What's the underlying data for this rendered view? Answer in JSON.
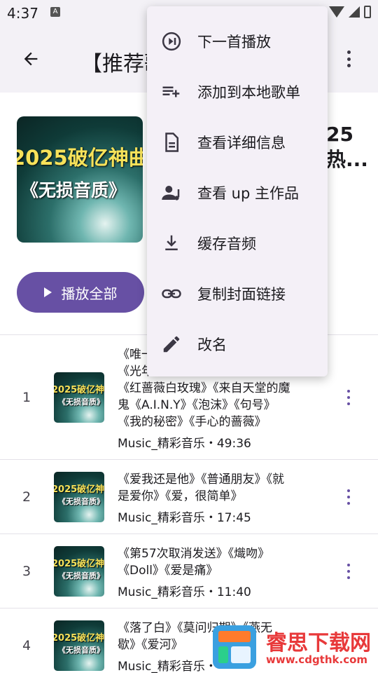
{
  "status": {
    "time": "4:37",
    "app_badge": "A"
  },
  "appbar": {
    "title": "【推荐歌"
  },
  "playlist": {
    "cover_line1": "2025破亿神曲",
    "cover_line2": "《无损音质》",
    "side_title_line1": "25",
    "side_title_line2": "热..."
  },
  "play_all_label": "播放全部",
  "songs": [
    {
      "index": "1",
      "title": "《唯一》《光年之外》《告白气球》《说散就散》《红蔷薇白玫瑰》《来自天堂的魔鬼《A.I.N.Y》《泡沫》《句号》《我的秘密》《手心的蔷薇》",
      "title_lines": [
        "《唯一",
        "《光年之外》《告白气球》《说散就散》",
        "《红蔷薇白玫瑰》《来自天堂的魔",
        "鬼《A.I.N.Y》《泡沫》《句号》",
        "《我的秘密》《手心的蔷薇》"
      ],
      "meta": "Music_精彩音乐・49:36",
      "thumb_line1": "2025破亿神曲",
      "thumb_line2": "《无损音质》"
    },
    {
      "index": "2",
      "title_lines": [
        "《爱我还是他》《普通朋友》《就",
        "是爱你》《爱，很简单》"
      ],
      "meta": "Music_精彩音乐・17:45",
      "thumb_line1": "2025破亿神曲",
      "thumb_line2": "《无损音质》"
    },
    {
      "index": "3",
      "title_lines": [
        "《第57次取消发送》《熾吻》",
        "《Doll》《爱是痛》"
      ],
      "meta": "Music_精彩音乐・11:40",
      "thumb_line1": "2025破亿神曲",
      "thumb_line2": "《无损音质》"
    },
    {
      "index": "4",
      "title_lines": [
        "《落了白》《莫问归期》《燕无",
        "歇》《爱河》"
      ],
      "meta": "Music_精彩音乐・",
      "thumb_line1": "2025破亿神曲",
      "thumb_line2": "《无损音质》"
    }
  ],
  "menu": {
    "items": [
      {
        "label": "下一首播放",
        "icon": "play-next-icon"
      },
      {
        "label": "添加到本地歌单",
        "icon": "playlist-add-icon"
      },
      {
        "label": "查看详细信息",
        "icon": "document-icon"
      },
      {
        "label": "查看 up 主作品",
        "icon": "artist-icon"
      },
      {
        "label": "缓存音频",
        "icon": "download-icon"
      },
      {
        "label": "复制封面链接",
        "icon": "link-icon"
      },
      {
        "label": "改名",
        "icon": "edit-icon"
      }
    ]
  },
  "watermark": {
    "name": "睿思下载网",
    "url": "www.cdgthk.com"
  },
  "colors": {
    "accent": "#6750a4",
    "menu_bg": "#f4f0f7",
    "appbar_bg": "#f3f1f6",
    "watermark": "#e8393a"
  }
}
